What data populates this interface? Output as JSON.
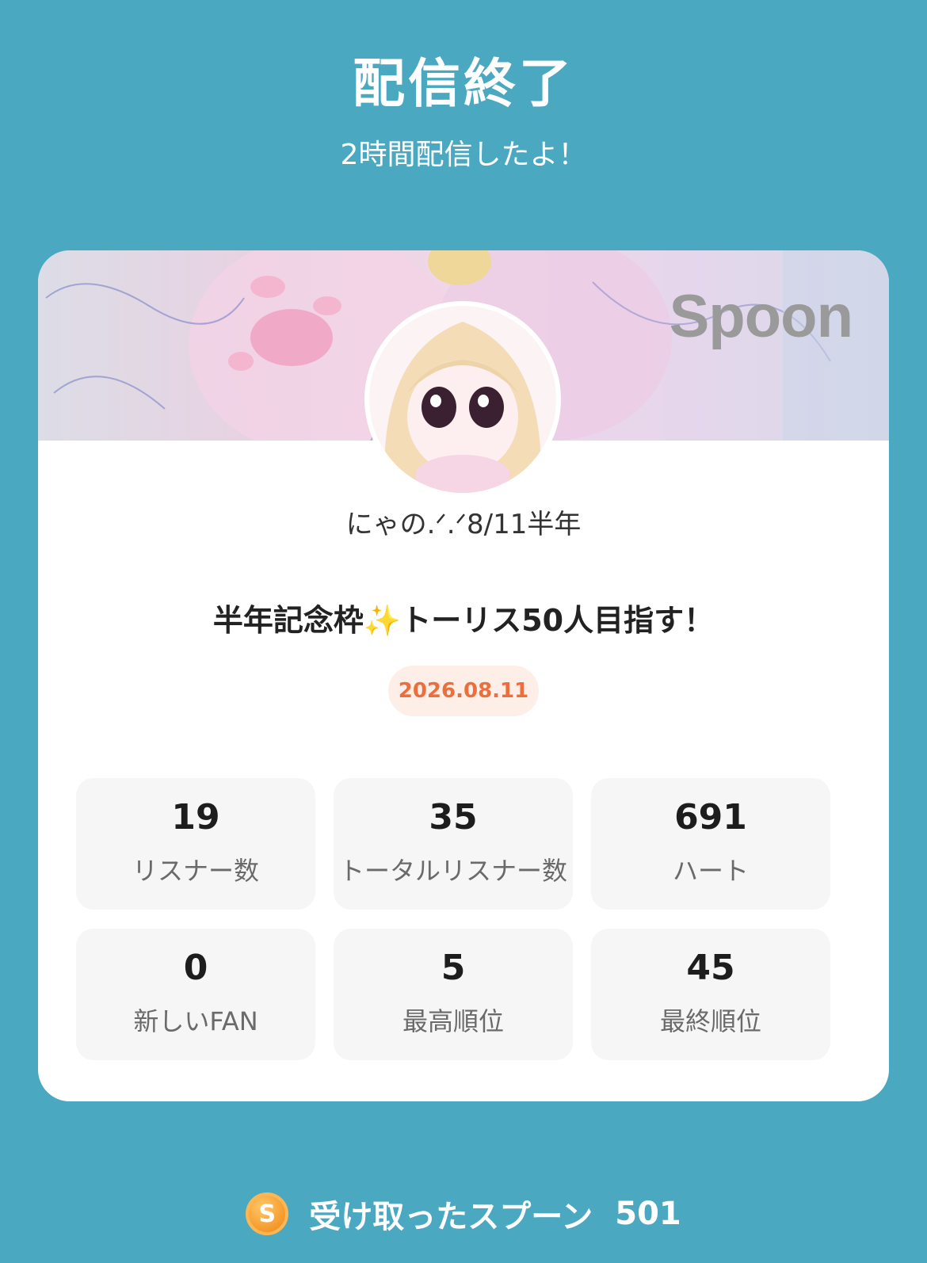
{
  "header": {
    "title": "配信終了",
    "subtitle": "2時間配信したよ！"
  },
  "card": {
    "banner_logo": "Spoon",
    "avatar_icon": "profile-avatar",
    "username": "にゃの.ᐟ.ᐟ8/11半年",
    "stream_title": "半年記念枠✨トーリス50人目指す！",
    "date": "2026.08.11",
    "date_color": "#ec6e3c"
  },
  "stats": [
    {
      "value": "19",
      "label": "リスナー数"
    },
    {
      "value": "35",
      "label": "トータルリスナー数"
    },
    {
      "value": "691",
      "label": "ハート"
    },
    {
      "value": "0",
      "label": "新しいFAN"
    },
    {
      "value": "5",
      "label": "最高順位"
    },
    {
      "value": "45",
      "label": "最終順位"
    }
  ],
  "footer": {
    "coin_icon": "spoon-coin-icon",
    "coin_letter": "S",
    "label": "受け取ったスプーン",
    "value": "501"
  },
  "colors": {
    "background": "#4aa8c0",
    "card": "#ffffff",
    "coin": "#f59a2c"
  }
}
